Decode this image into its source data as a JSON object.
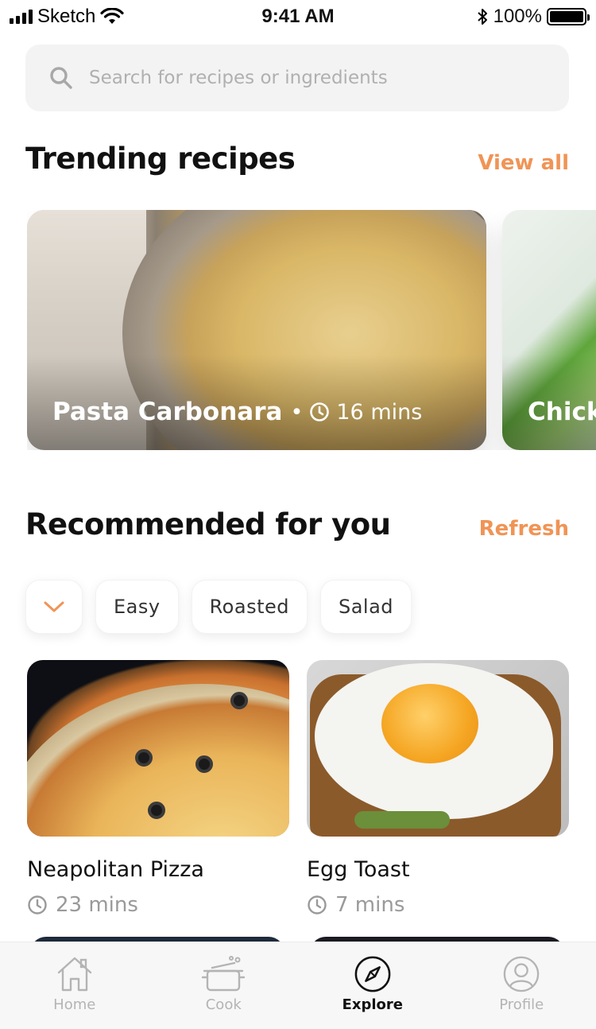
{
  "status_bar": {
    "carrier": "Sketch",
    "time": "9:41 AM",
    "battery": "100%"
  },
  "search": {
    "placeholder": "Search for recipes or ingredients"
  },
  "trending": {
    "title": "Trending recipes",
    "view_all": "View all",
    "cards": [
      {
        "name": "Pasta Carbonara",
        "separator": "•",
        "time": "16 mins"
      },
      {
        "name": "Chick"
      }
    ]
  },
  "recommended": {
    "title": "Recommended for you",
    "refresh": "Refresh",
    "chips": [
      "Easy",
      "Roasted",
      "Salad"
    ],
    "items": [
      {
        "name": "Neapolitan Pizza",
        "time": "23 mins"
      },
      {
        "name": "Egg Toast",
        "time": "7 mins"
      }
    ]
  },
  "tabbar": {
    "items": [
      {
        "label": "Home",
        "icon": "home-icon",
        "active": false
      },
      {
        "label": "Cook",
        "icon": "cooking-pot-icon",
        "active": false
      },
      {
        "label": "Explore",
        "icon": "compass-icon",
        "active": true
      },
      {
        "label": "Profile",
        "icon": "user-icon",
        "active": false
      }
    ]
  },
  "colors": {
    "accent": "#f09456",
    "muted_text": "#9a9a9a",
    "search_bg": "#f3f3f3"
  }
}
